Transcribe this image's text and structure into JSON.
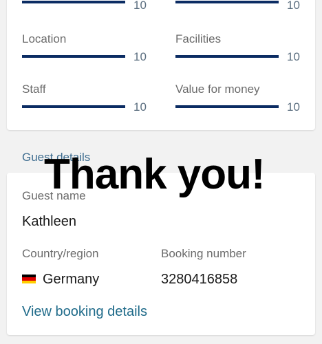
{
  "ratings": {
    "top_left": {
      "score": "10",
      "value": 1.0
    },
    "top_right": {
      "score": "10",
      "value": 1.0
    },
    "location": {
      "label": "Location",
      "score": "10",
      "value": 1.0
    },
    "facilities": {
      "label": "Facilities",
      "score": "10",
      "value": 1.0
    },
    "staff": {
      "label": "Staff",
      "score": "10",
      "value": 1.0
    },
    "value_for_money": {
      "label": "Value for money",
      "score": "10",
      "value": 1.0
    }
  },
  "guest_details": {
    "section_title": "Guest details",
    "guest_name_label": "Guest name",
    "guest_name": "Kathleen",
    "country_label": "Country/region",
    "country": "Germany",
    "country_flag": "germany-flag-icon",
    "booking_number_label": "Booking number",
    "booking_number": "3280416858",
    "view_link": "View booking details"
  },
  "overlay_text": "Thank you!",
  "colors": {
    "bar": "#0b2c63",
    "score": "#5c6f80",
    "link": "#1e6a89",
    "section_title": "#3d6c8f",
    "flag_black": "#000000",
    "flag_red": "#dd0000",
    "flag_gold": "#ffce00"
  }
}
